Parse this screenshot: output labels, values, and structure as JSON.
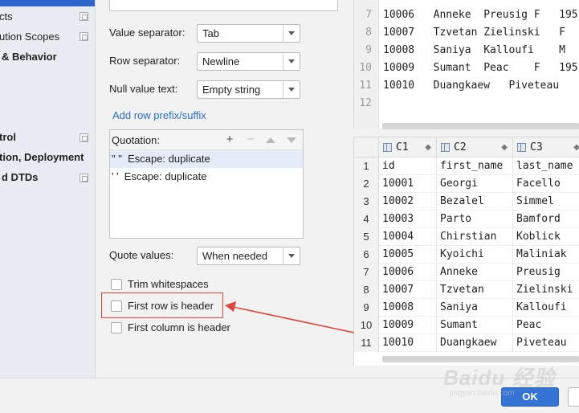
{
  "sidebar": {
    "items": [
      {
        "label": "cts",
        "bold": false,
        "copy": true
      },
      {
        "label": "ution Scopes",
        "bold": false,
        "copy": true
      },
      {
        "label": "& Behavior",
        "bold": true,
        "copy": false
      },
      {
        "label": "trol",
        "bold": true,
        "copy": true
      },
      {
        "label": "tion, Deployment",
        "bold": true,
        "copy": false
      },
      {
        "label": "d DTDs",
        "bold": true,
        "copy": true
      }
    ]
  },
  "settings": {
    "value_separator_label": "Value separator:",
    "value_separator": "Tab",
    "row_separator_label": "Row separator:",
    "row_separator": "Newline",
    "null_value_label": "Null value text:",
    "null_value": "Empty string",
    "add_prefix_link": "Add row prefix/suffix",
    "quotation_label": "Quotation:",
    "quotations": [
      "\" \"  Escape: duplicate",
      "' '  Escape: duplicate"
    ],
    "quote_values_label": "Quote values:",
    "quote_values": "When needed",
    "trim_whitespaces": "Trim whitespaces",
    "first_row_header": "First row is header",
    "first_column_header": "First column is header"
  },
  "text_preview": {
    "lines": [
      {
        "n": "7",
        "text": "10006   Anneke  Preusig F   195"
      },
      {
        "n": "8",
        "text": "10007   Tzvetan Zielinski   F"
      },
      {
        "n": "9",
        "text": "10008   Saniya  Kalloufi    M"
      },
      {
        "n": "10",
        "text": "10009   Sumant  Peac    F   195"
      },
      {
        "n": "11",
        "text": "10010   Duangkaew   Piveteau"
      },
      {
        "n": "12",
        "text": ""
      }
    ]
  },
  "grid": {
    "columns": [
      "C1",
      "C2",
      "C3"
    ],
    "rows": [
      {
        "n": "1",
        "cells": [
          "id",
          "first_name",
          "last_name"
        ]
      },
      {
        "n": "2",
        "cells": [
          "10001",
          "Georgi",
          "Facello"
        ]
      },
      {
        "n": "3",
        "cells": [
          "10002",
          "Bezalel",
          "Simmel"
        ]
      },
      {
        "n": "4",
        "cells": [
          "10003",
          "Parto",
          "Bamford"
        ]
      },
      {
        "n": "5",
        "cells": [
          "10004",
          "Chirstian",
          "Koblick"
        ]
      },
      {
        "n": "6",
        "cells": [
          "10005",
          "Kyoichi",
          "Maliniak"
        ]
      },
      {
        "n": "7",
        "cells": [
          "10006",
          "Anneke",
          "Preusig"
        ]
      },
      {
        "n": "8",
        "cells": [
          "10007",
          "Tzvetan",
          "Zielinski"
        ]
      },
      {
        "n": "9",
        "cells": [
          "10008",
          "Saniya",
          "Kalloufi"
        ]
      },
      {
        "n": "10",
        "cells": [
          "10009",
          "Sumant",
          "Peac"
        ]
      },
      {
        "n": "11",
        "cells": [
          "10010",
          "Duangkaew",
          "Piveteau"
        ]
      }
    ]
  },
  "footer": {
    "ok_label": "OK"
  },
  "watermark": {
    "brand": "Baidu 经验",
    "url": "jingyan.baidu.com"
  },
  "colors": {
    "accent": "#3574d4",
    "highlight": "#e0443c",
    "link": "#2a6fc9"
  }
}
